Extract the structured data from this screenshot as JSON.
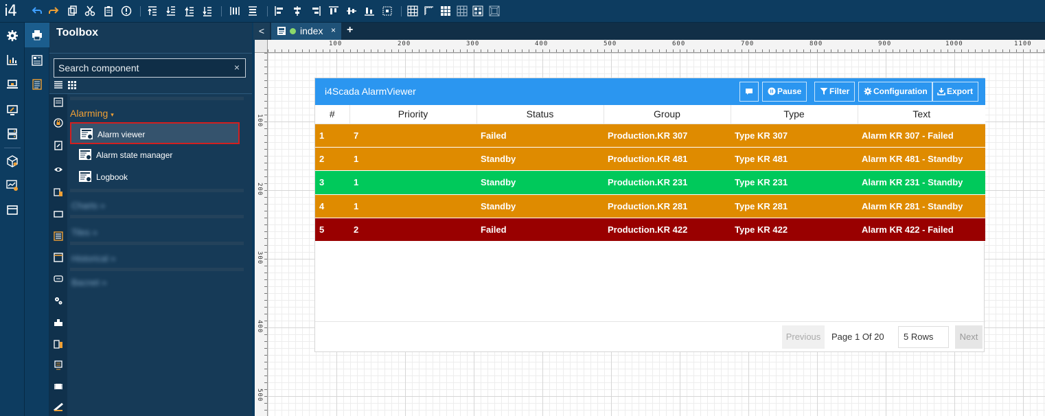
{
  "app": {
    "logo": "i4"
  },
  "toolbox": {
    "title": "Toolbox",
    "search_placeholder": "Search component",
    "clear_icon": "×",
    "group": {
      "label": "Alarming",
      "caret": "▾"
    },
    "items": [
      {
        "label": "Alarm viewer",
        "icon": "alarm-viewer-icon"
      },
      {
        "label": "Alarm state manager",
        "icon": "alarm-viewer-icon"
      },
      {
        "label": "Logbook",
        "icon": "alarm-viewer-icon"
      }
    ],
    "blurred_groups": [
      "Charts »",
      "Tiles »",
      "Historical »",
      "Bacnet »"
    ]
  },
  "editor": {
    "back_icon": "<",
    "tab": {
      "label": "index",
      "close": "×",
      "status_color": "#8bd86a"
    },
    "add_tab": "+",
    "ruler_x": [
      "100",
      "200",
      "300",
      "400",
      "500",
      "600",
      "700",
      "800",
      "900",
      "1000",
      "1100"
    ],
    "ruler_y": [
      "100",
      "200",
      "300",
      "400",
      "500"
    ]
  },
  "alarm_viewer": {
    "title": "i4Scada AlarmViewer",
    "buttons": {
      "pause": "Pause",
      "filter": "Filter",
      "configuration": "Configuration",
      "export": "Export"
    },
    "columns": [
      "#",
      "Priority",
      "Status",
      "Group",
      "Type",
      "Text"
    ],
    "rows": [
      {
        "num": "1",
        "priority": "7",
        "status": "Failed",
        "group": "Production.KR 307",
        "type": "Type KR 307",
        "text": "Alarm KR 307 - Failed",
        "color": "#df8b00"
      },
      {
        "num": "2",
        "priority": "1",
        "status": "Standby",
        "group": "Production.KR 481",
        "type": "Type KR 481",
        "text": "Alarm KR 481 - Standby",
        "color": "#df8b00"
      },
      {
        "num": "3",
        "priority": "1",
        "status": "Standby",
        "group": "Production.KR 231",
        "type": "Type KR 231",
        "text": "Alarm KR 231 - Standby",
        "color": "#00c95b"
      },
      {
        "num": "4",
        "priority": "1",
        "status": "Standby",
        "group": "Production.KR 281",
        "type": "Type KR 281",
        "text": "Alarm KR 281 - Standby",
        "color": "#df8b00"
      },
      {
        "num": "5",
        "priority": "2",
        "status": "Failed",
        "group": "Production.KR 422",
        "type": "Type KR 422",
        "text": "Alarm KR 422 - Failed",
        "color": "#990000"
      }
    ],
    "pagination": {
      "previous": "Previous",
      "page_label": "Page 1 Of 20",
      "rows_select": "5 Rows",
      "next": "Next"
    }
  },
  "colors": {
    "header_blue": "#2b96f0",
    "selected_border": "#d31f1f",
    "group_accent": "#f0a035"
  }
}
